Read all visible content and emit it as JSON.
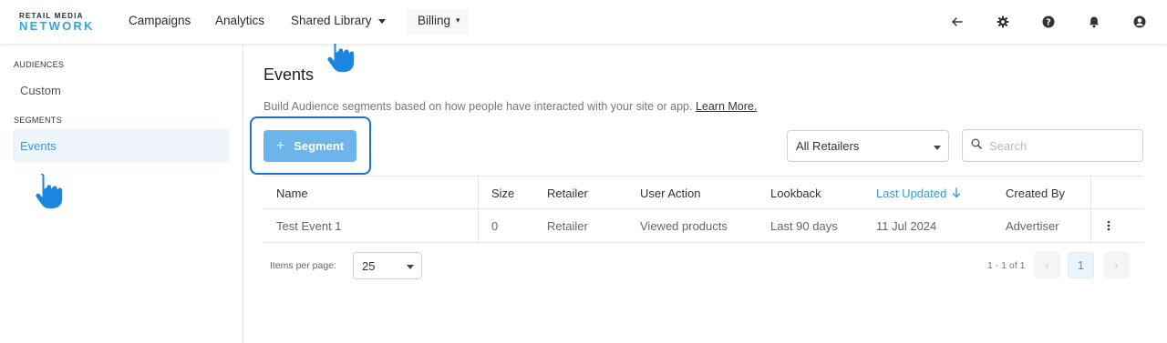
{
  "logo": {
    "top": "RETAIL MEDIA",
    "bottom": "NETWORK"
  },
  "nav": {
    "campaigns": "Campaigns",
    "analytics": "Analytics",
    "shared_library": "Shared Library",
    "billing": "Billing"
  },
  "sidebar": {
    "audiences_header": "AUDIENCES",
    "custom": "Custom",
    "segments_header": "SEGMENTS",
    "events": "Events"
  },
  "page": {
    "title": "Events",
    "description": "Build Audience segments based on how people have interacted with your site or app.",
    "learn_more": "Learn More.",
    "add_segment_label": "Segment",
    "retailer_select_value": "All Retailers",
    "search_placeholder": "Search"
  },
  "table": {
    "columns": [
      "Name",
      "Size",
      "Retailer",
      "User Action",
      "Lookback",
      "Last Updated",
      "Created By"
    ],
    "rows": [
      [
        "Test Event 1",
        "0",
        "Retailer",
        "Viewed products",
        "Last 90 days",
        "11 Jul 2024",
        "Advertiser"
      ]
    ]
  },
  "pagination": {
    "items_per_page_label": "Items per page:",
    "items_per_page_value": "25",
    "range": "1 - 1 of 1",
    "current_page": "1"
  },
  "colors": {
    "accent": "#3b98e0",
    "button": "#6cb4ea",
    "highlight": "#1a75d1"
  }
}
